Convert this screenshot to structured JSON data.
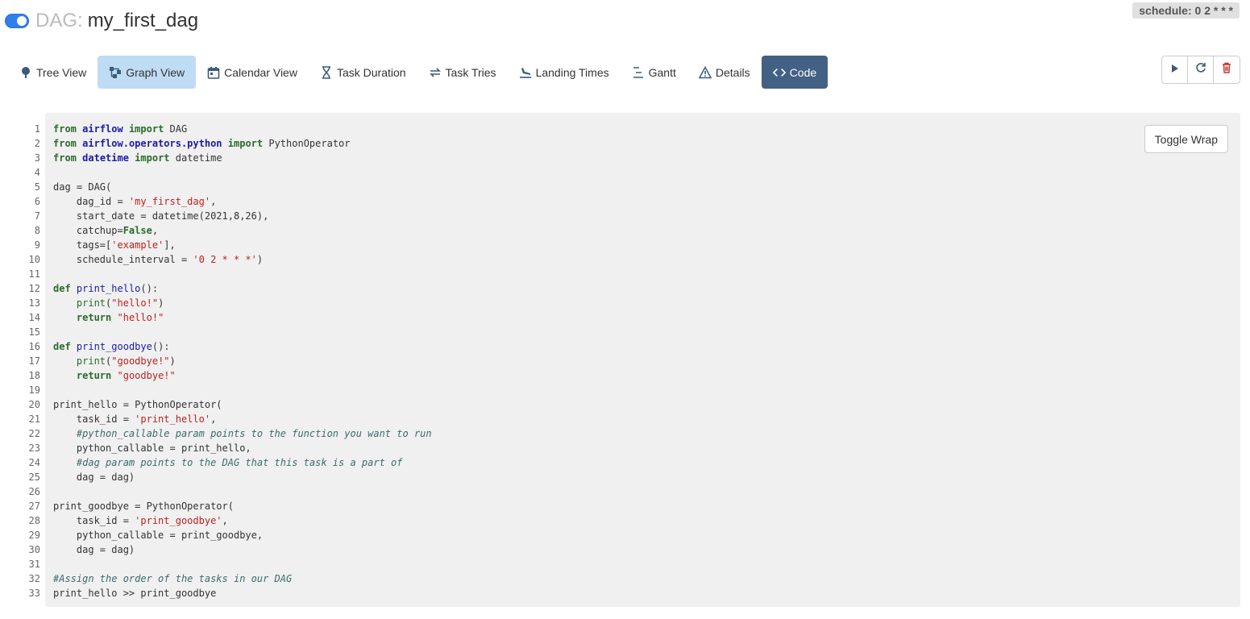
{
  "header": {
    "dag_prefix": "DAG:",
    "dag_name": "my_first_dag",
    "schedule_label": "schedule:",
    "schedule_value": "0 2 * * *"
  },
  "tabs": [
    {
      "label": "Tree View",
      "icon": "tree-icon"
    },
    {
      "label": "Graph View",
      "icon": "graph-icon"
    },
    {
      "label": "Calendar View",
      "icon": "calendar-icon"
    },
    {
      "label": "Task Duration",
      "icon": "hourglass-icon"
    },
    {
      "label": "Task Tries",
      "icon": "retry-icon"
    },
    {
      "label": "Landing Times",
      "icon": "landing-icon"
    },
    {
      "label": "Gantt",
      "icon": "gantt-icon"
    },
    {
      "label": "Details",
      "icon": "warning-triangle-icon"
    },
    {
      "label": "Code",
      "icon": "code-icon"
    }
  ],
  "actions": [
    "play-icon",
    "refresh-icon",
    "trash-icon"
  ],
  "colors": {
    "accent": "#436085",
    "active_tab": "#bfdcf5",
    "toggle": "#2f7ff0",
    "delete": "#c9302c"
  },
  "code_panel": {
    "toggle_wrap_label": "Toggle Wrap",
    "lines": [
      "from airflow import DAG",
      "from airflow.operators.python import PythonOperator",
      "from datetime import datetime",
      "",
      "dag = DAG(",
      "    dag_id = 'my_first_dag',",
      "    start_date = datetime(2021,8,26),",
      "    catchup=False,",
      "    tags=['example'],",
      "    schedule_interval = '0 2 * * *')",
      "",
      "def print_hello():",
      "    print(\"hello!\")",
      "    return \"hello!\"",
      "",
      "def print_goodbye():",
      "    print(\"goodbye!\")",
      "    return \"goodbye!\"",
      "",
      "print_hello = PythonOperator(",
      "    task_id = 'print_hello',",
      "    #python_callable param points to the function you want to run",
      "    python_callable = print_hello,",
      "    #dag param points to the DAG that this task is a part of",
      "    dag = dag)",
      "",
      "print_goodbye = PythonOperator(",
      "    task_id = 'print_goodbye',",
      "    python_callable = print_goodbye,",
      "    dag = dag)",
      "",
      "#Assign the order of the tasks in our DAG",
      "print_hello >> print_goodbye"
    ]
  }
}
